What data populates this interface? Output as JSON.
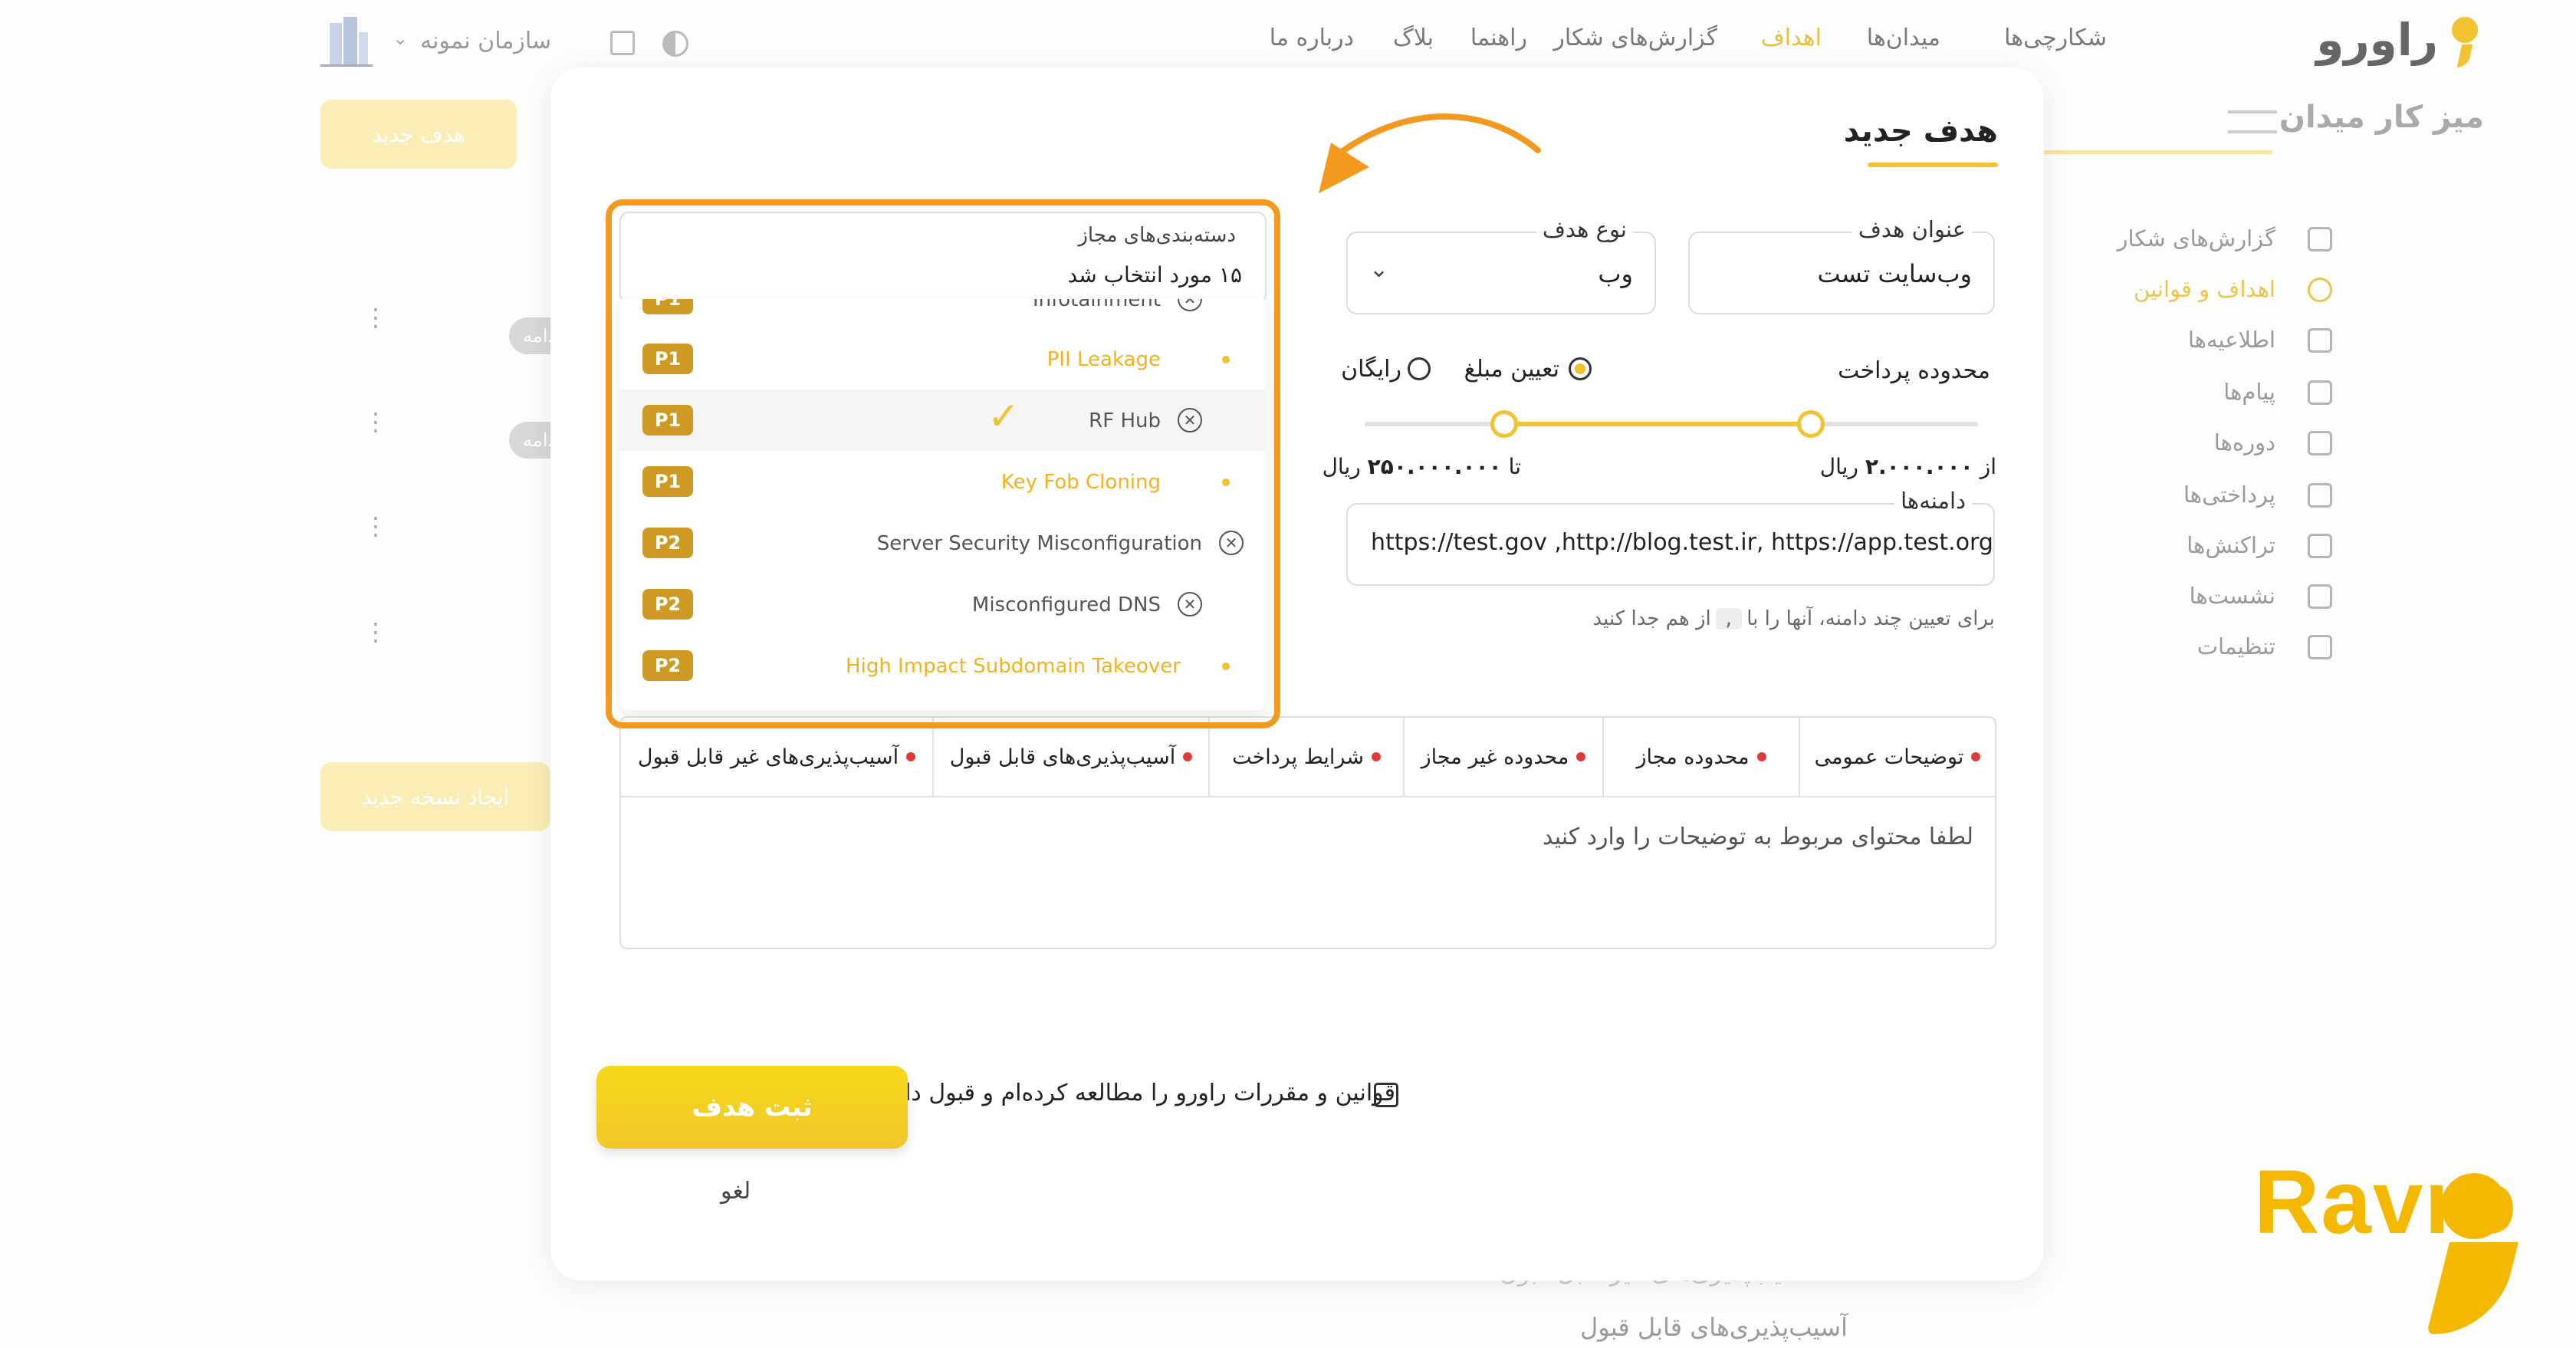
{
  "brand": {
    "name": "راورو",
    "watermark": "Ravro",
    "accent": "#f2c230",
    "highlight": "#f39a1e"
  },
  "topnav": {
    "items": [
      "شکارچی‌ها",
      "میدان‌ها",
      "اهداف",
      "گزارش‌های شکار",
      "راهنما",
      "بلاگ",
      "درباره ما"
    ],
    "active": "اهداف",
    "org": "سازمان نمونه"
  },
  "background": {
    "new_target_button": "هدف جدید",
    "new_version_button": "ایجاد نسخه جدید",
    "pill": "ادامه",
    "dashboard_title": "میز کار میدان",
    "sidebar": [
      "گزارش‌های شکار",
      "اهداف و قوانین",
      "اطلاعیه‌ها",
      "پیام‌ها",
      "دوره‌ها",
      "پرداختی‌ها",
      "تراکنش‌ها",
      "نشست‌ها",
      "تنظیمات"
    ],
    "sidebar_active": "اهداف و قوانین",
    "bottom_text_1": "آسیب‌پذیری‌های غیر قابل قبول",
    "bottom_text_2": "آسیب‌پذیری‌های قابل قبول"
  },
  "modal": {
    "title": "هدف جدید",
    "target_title": {
      "label": "عنوان هدف",
      "value": "وب‌سایت تست"
    },
    "target_type": {
      "label": "نوع هدف",
      "value": "وب"
    },
    "payment": {
      "label": "محدوده پرداخت",
      "option_set_amount": "تعیین مبلغ",
      "option_free": "رایگان",
      "selected": "تعیین مبلغ",
      "from_label": "از",
      "from_value": "۲.۰۰۰.۰۰۰",
      "to_label": "تا",
      "to_value": "۲۵۰.۰۰۰.۰۰۰",
      "currency": "ریال"
    },
    "domains": {
      "label": "دامنه‌ها",
      "value": "https://test.gov ,http://blog.test.ir, https://app.test.org",
      "hint_before": "برای تعیین چند دامنه، آنها را با",
      "hint_code": ",",
      "hint_after": "از هم جدا کنید"
    },
    "categories": {
      "label": "دسته‌بندی‌های مجاز",
      "summary": "۱۵ مورد انتخاب شد",
      "items": [
        {
          "priority": "P1",
          "name": "Infotainment",
          "selected": true
        },
        {
          "priority": "P1",
          "name": "PII Leakage",
          "selected": false
        },
        {
          "priority": "P1",
          "name": "RF Hub",
          "selected": true,
          "hover": true
        },
        {
          "priority": "P1",
          "name": "Key Fob Cloning",
          "selected": false
        },
        {
          "priority": "P2",
          "name": "Server Security Misconfiguration",
          "selected": true
        },
        {
          "priority": "P2",
          "name": "Misconfigured DNS",
          "selected": true
        },
        {
          "priority": "P2",
          "name": "High Impact Subdomain Takeover",
          "selected": false
        }
      ]
    },
    "tabs": [
      "توضیحات عمومی",
      "محدوده مجاز",
      "محدوده غیر مجاز",
      "شرایط پرداخت",
      "آسیب‌پذیری‌های قابل قبول",
      "آسیب‌پذیری‌های غیر قابل قبول"
    ],
    "description_placeholder": "لطفا محتوای مربوط به توضیحات را وارد کنید",
    "terms_label": "قوانین و مقررات راورو را مطالعه کرده‌ام و قبول دارم",
    "submit_label": "ثبت هدف",
    "cancel_label": "لغو"
  }
}
